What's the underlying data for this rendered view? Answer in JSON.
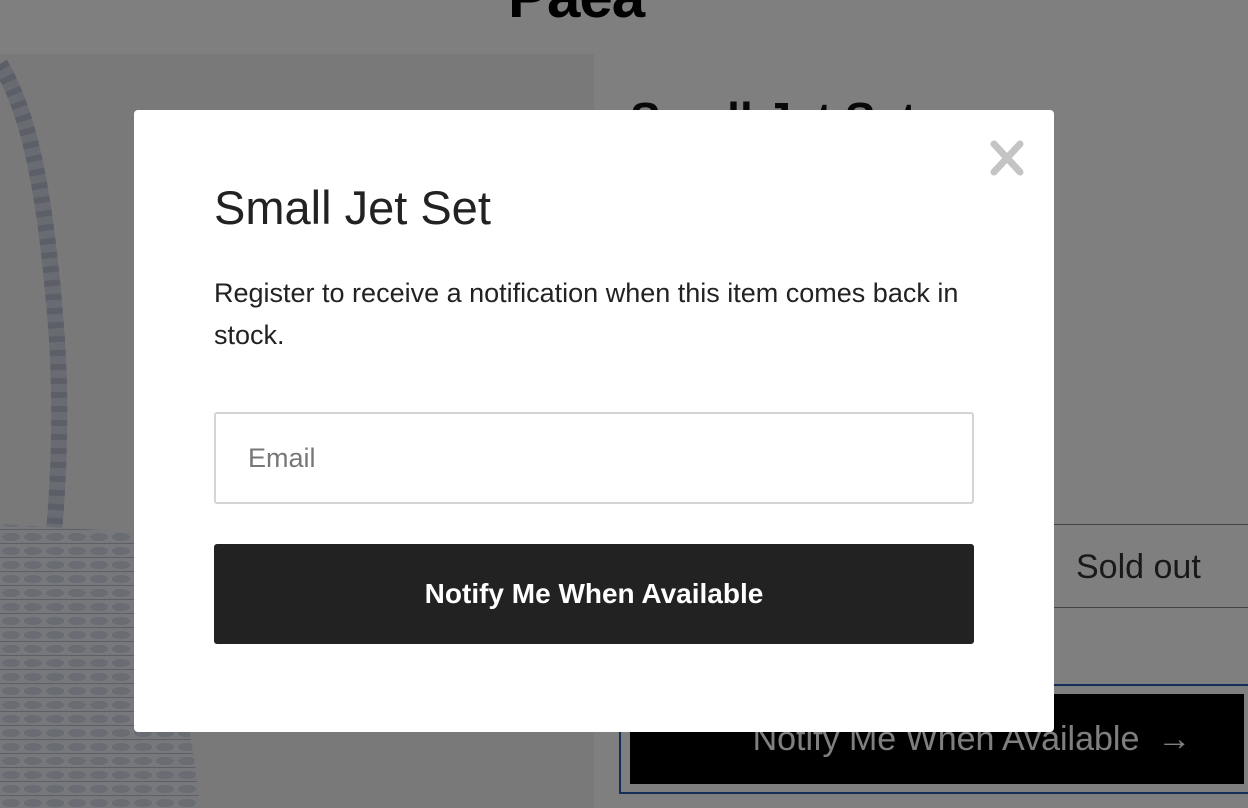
{
  "page": {
    "brand": "Paéa",
    "product_title": "Small Jet Set",
    "variant_status": "Sold out",
    "notify_button_label": "Notify Me When Available",
    "notify_arrow": "→"
  },
  "modal": {
    "title": "Small Jet Set",
    "description": "Register to receive a notification when this item comes back in stock.",
    "email_placeholder": "Email",
    "email_value": "",
    "submit_label": "Notify Me When Available",
    "close_icon": "close-icon"
  },
  "colors": {
    "overlay": "rgba(0,0,0,0.5)",
    "modal_button": "#222222",
    "page_button": "#000000",
    "focus_outline": "#2a5db0"
  }
}
